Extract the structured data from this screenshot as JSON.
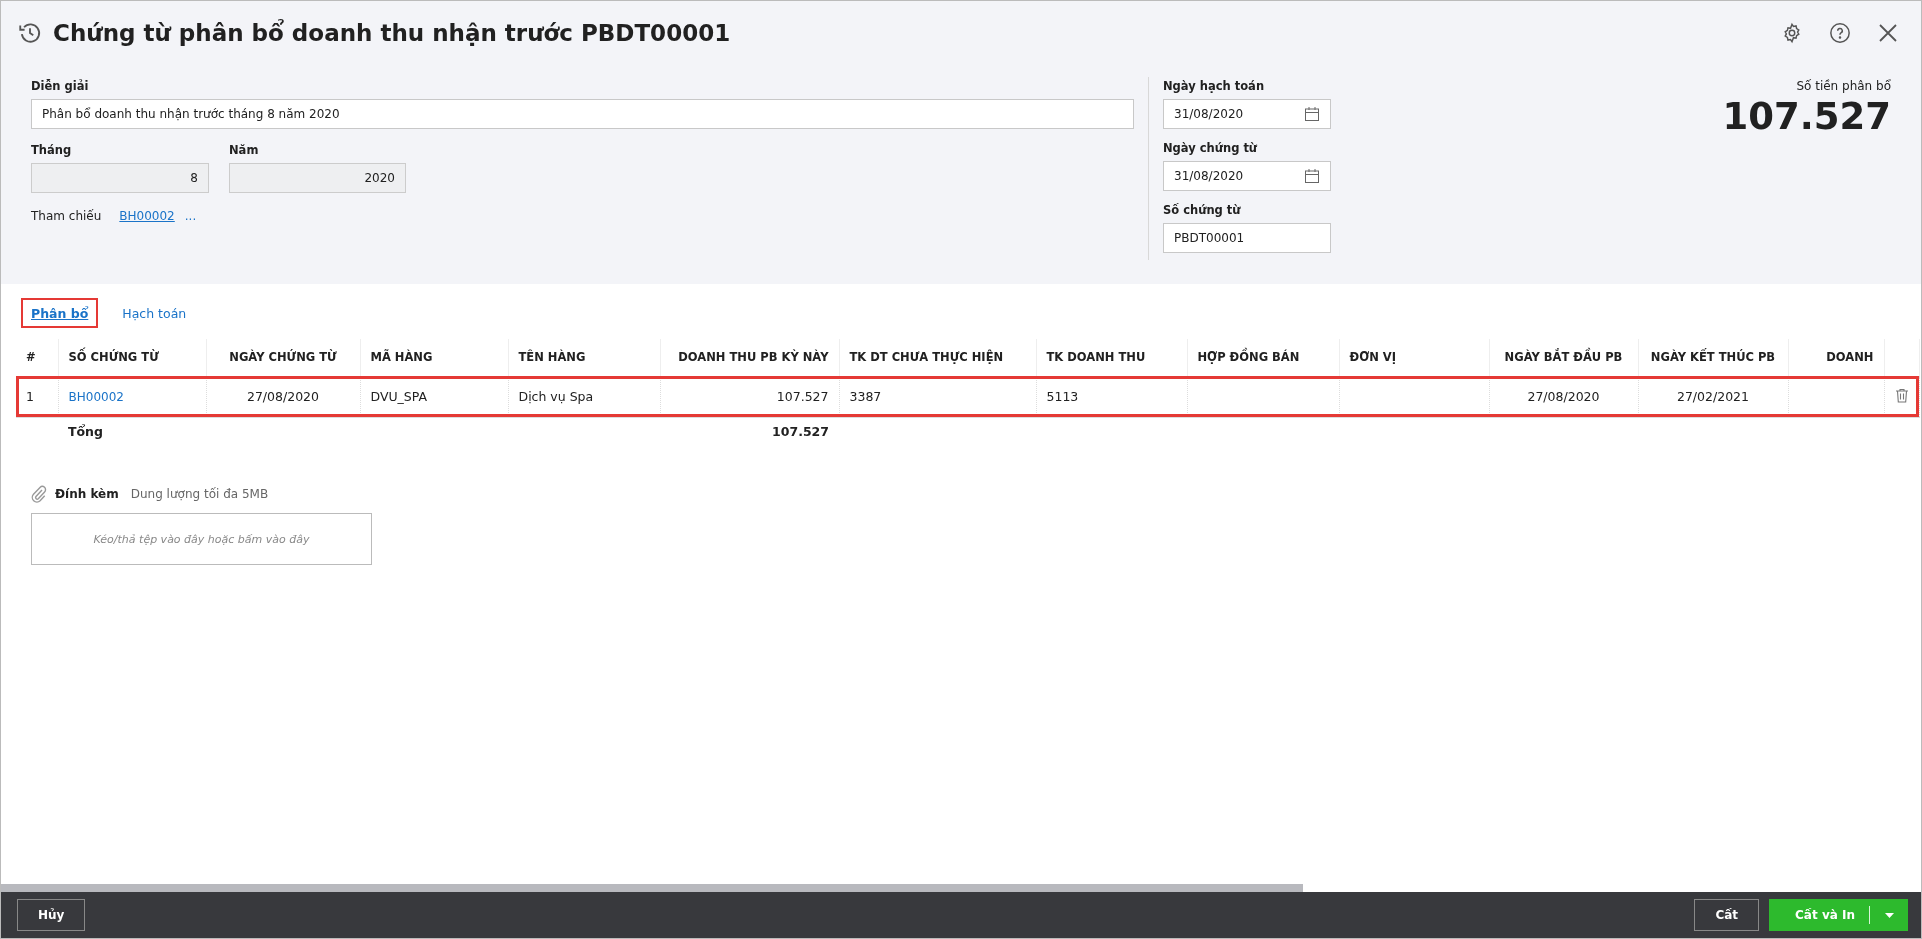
{
  "window": {
    "title": "Chứng từ phân bổ doanh thu nhận trước PBDT00001"
  },
  "form": {
    "description": {
      "label": "Diễn giải",
      "value": "Phân bổ doanh thu nhận trước tháng 8 năm 2020"
    },
    "month": {
      "label": "Tháng",
      "value": "8"
    },
    "year": {
      "label": "Năm",
      "value": "2020"
    },
    "reference": {
      "label": "Tham chiếu",
      "link": "BH00002",
      "more": "..."
    },
    "posting_date": {
      "label": "Ngày hạch toán",
      "value": "31/08/2020"
    },
    "voucher_date": {
      "label": "Ngày chứng từ",
      "value": "31/08/2020"
    },
    "voucher_no": {
      "label": "Số chứng từ",
      "value": "PBDT00001"
    }
  },
  "amount": {
    "label": "Số tiền phân bổ",
    "value": "107.527"
  },
  "tabs": [
    {
      "label": "Phân bổ",
      "selected": true,
      "highlighted": true
    },
    {
      "label": "Hạch toán",
      "selected": false,
      "highlighted": false
    }
  ],
  "table": {
    "columns": [
      "#",
      "SỐ CHỨNG TỪ",
      "NGÀY CHỨNG TỪ",
      "MÃ HÀNG",
      "TÊN HÀNG",
      "DOANH THU PB KỲ NÀY",
      "TK DT CHƯA THỰC HIỆN",
      "TK DOANH THU",
      "HỢP ĐỒNG BÁN",
      "ĐƠN VỊ",
      "NGÀY BẮT ĐẦU PB",
      "NGÀY KẾT THÚC PB",
      "DOANH"
    ],
    "rows": [
      {
        "highlighted": true,
        "cells": [
          {
            "kind": "text",
            "text": "1"
          },
          {
            "kind": "link",
            "text": "BH00002"
          },
          {
            "kind": "text",
            "text": "27/08/2020"
          },
          {
            "kind": "text",
            "text": "DVU_SPA"
          },
          {
            "kind": "text",
            "text": "Dịch vụ Spa"
          },
          {
            "kind": "text",
            "text": "107.527"
          },
          {
            "kind": "text",
            "text": "3387"
          },
          {
            "kind": "text",
            "text": "5113"
          },
          {
            "kind": "empty"
          },
          {
            "kind": "empty"
          },
          {
            "kind": "text",
            "text": "27/08/2020"
          },
          {
            "kind": "text",
            "text": "27/02/2021"
          },
          {
            "kind": "empty"
          }
        ]
      }
    ],
    "total": {
      "label": "Tổng",
      "value": "107.527"
    }
  },
  "attachment": {
    "label": "Đính kèm",
    "hint": "Dung lượng tối đa 5MB",
    "dropzone": "Kéo/thả tệp vào đây hoặc bấm vào đây"
  },
  "footer": {
    "cancel": "Hủy",
    "save": "Cất",
    "save_print": "Cất và In"
  }
}
